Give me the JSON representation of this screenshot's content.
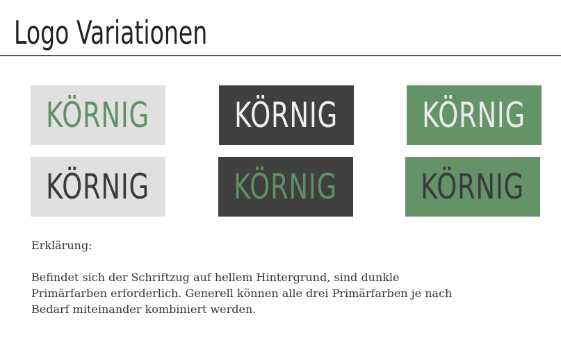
{
  "title": "Logo Variationen",
  "logos": [
    {
      "text": "KÖRNIG",
      "bg": "#e0e0e0",
      "color": "#5f9167"
    },
    {
      "text": "KÖRNIG",
      "bg": "#3f3f40",
      "color": "#efefef"
    },
    {
      "text": "KÖRNIG",
      "bg": "#639366",
      "color": "#eaeaea"
    },
    {
      "text": "KÖRNIG",
      "bg": "#e0e0e0",
      "color": "#3a3a3a"
    },
    {
      "text": "KÖRNIG",
      "bg": "#3f3f40",
      "color": "#5f9167"
    },
    {
      "text": "KÖRNIG",
      "bg": "#639366",
      "color": "#3a3a3a"
    }
  ],
  "explanation": {
    "heading": "Erklärung:",
    "lines": [
      "Befindet sich der Schriftzug auf hellem Hintergrund, sind dunkle",
      "Primärfarben erforderlich. Generell können alle drei Primärfarben je nach",
      "Bedarf miteinander kombiniert werden."
    ]
  }
}
